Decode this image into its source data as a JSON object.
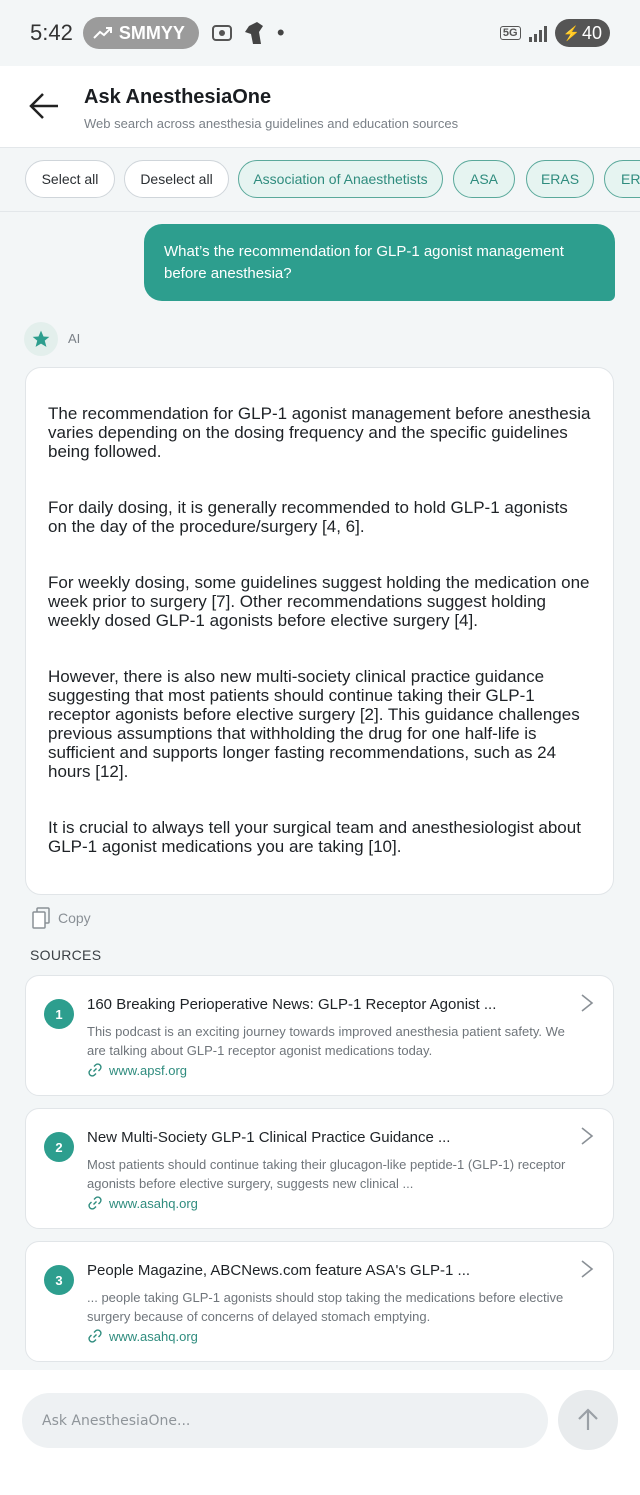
{
  "status_bar": {
    "time": "5:42",
    "pill_label": "SMMYY",
    "network": "5G",
    "battery": "40"
  },
  "header": {
    "title": "Ask AnesthesiaOne",
    "subtitle": "Web search across anesthesia guidelines and education sources"
  },
  "filters": [
    {
      "label": "Select all",
      "selected": false
    },
    {
      "label": "Deselect all",
      "selected": false
    },
    {
      "label": "Association of Anaesthetists",
      "selected": true
    },
    {
      "label": "ASA",
      "selected": true
    },
    {
      "label": "ERAS",
      "selected": true
    },
    {
      "label": "ER",
      "selected": true
    }
  ],
  "user_message": "What’s the recommendation for GLP-1 agonist management before anesthesia?",
  "ai_label": "AI",
  "answer_paragraphs": [
    "The recommendation for GLP-1 agonist management before anesthesia varies depending on the dosing frequency and the specific guidelines being followed.",
    "For daily dosing, it is generally recommended to hold GLP-1 agonists on the day of the procedure/surgery [4, 6].",
    "For weekly dosing, some guidelines suggest holding the medication one week prior to surgery [7]. Other recommendations suggest holding weekly dosed GLP-1 agonists before elective surgery [4].",
    "However, there is also new multi-society clinical practice guidance suggesting that most patients should continue taking their GLP-1 receptor agonists before elective surgery [2]. This guidance challenges previous assumptions that withholding the drug for one half-life is sufficient and supports longer fasting recommendations, such as 24 hours [12].",
    "It is crucial to always tell your surgical team and anesthesiologist about GLP-1 agonist medications you are taking [10]."
  ],
  "copy_label": "Copy",
  "sources_title": "SOURCES",
  "sources": [
    {
      "num": "1",
      "title": "160 Breaking Perioperative News: GLP-1 Receptor Agonist ...",
      "snippet": "This podcast is an exciting journey towards improved anesthesia patient safety. We are talking about GLP-1 receptor agonist medications today.",
      "domain": "www.apsf.org"
    },
    {
      "num": "2",
      "title": "New Multi-Society GLP-1 Clinical Practice Guidance ...",
      "snippet": "Most patients should continue taking their glucagon-like peptide-1 (GLP-1) receptor agonists before elective surgery, suggests new clinical ...",
      "domain": "www.asahq.org"
    },
    {
      "num": "3",
      "title": "People Magazine, ABCNews.com feature ASA's GLP-1 ...",
      "snippet": "... people taking GLP-1 agonists should stop taking the medications before elective surgery because of concerns of delayed stomach emptying.",
      "domain": "www.asahq.org"
    }
  ],
  "composer": {
    "placeholder": "Ask AnesthesiaOne..."
  },
  "colors": {
    "accent": "#2d9e8e",
    "chip_selected_bg": "#e6f4f1",
    "background": "#f3f6f7"
  }
}
